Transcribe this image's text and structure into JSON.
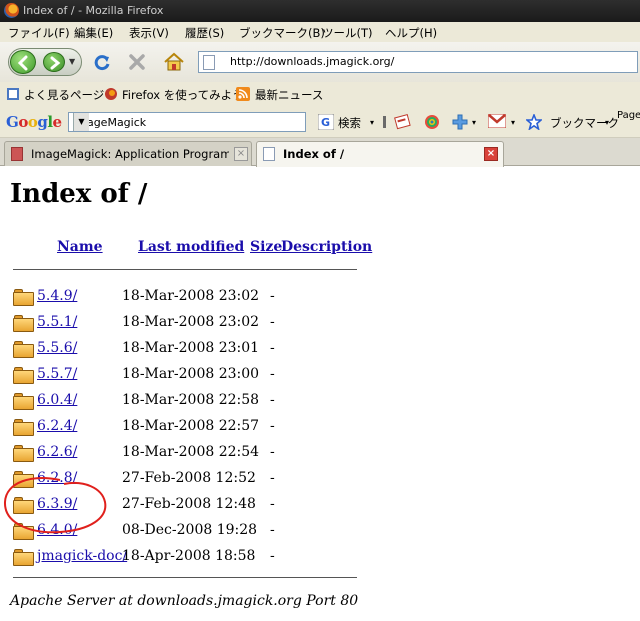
{
  "window": {
    "title": "Index of / - Mozilla Firefox"
  },
  "menu": [
    "ファイル(F)",
    "編集(E)",
    "表示(V)",
    "履歴(S)",
    "ブックマーク(B)",
    "ツール(T)",
    "ヘルプ(H)"
  ],
  "nav": {
    "url": "http://downloads.jmagick.org/"
  },
  "bookmarks": [
    "よく見るページ",
    "Firefox を使ってみよう",
    "最新ニュース"
  ],
  "google": {
    "logo": "Google",
    "query": "ImageMagick",
    "search_label": "検索",
    "bookmarks_label": "ブックマーク",
    "page_label": "Pagel"
  },
  "tabs": [
    {
      "label": "ImageMagick: Application Program Int...",
      "active": false
    },
    {
      "label": "Index of /",
      "active": true
    }
  ],
  "page": {
    "heading": "Index of /",
    "columns": [
      "Name",
      "Last modified",
      "Size",
      "Description"
    ],
    "rows": [
      {
        "name": "5.4.9/",
        "modified": "18-Mar-2008 23:02",
        "size": "-"
      },
      {
        "name": "5.5.1/",
        "modified": "18-Mar-2008 23:02",
        "size": "-"
      },
      {
        "name": "5.5.6/",
        "modified": "18-Mar-2008 23:01",
        "size": "-"
      },
      {
        "name": "5.5.7/",
        "modified": "18-Mar-2008 23:00",
        "size": "-"
      },
      {
        "name": "6.0.4/",
        "modified": "18-Mar-2008 22:58",
        "size": "-"
      },
      {
        "name": "6.2.4/",
        "modified": "18-Mar-2008 22:57",
        "size": "-"
      },
      {
        "name": "6.2.6/",
        "modified": "18-Mar-2008 22:54",
        "size": "-"
      },
      {
        "name": "6.2.8/",
        "modified": "27-Feb-2008 12:52",
        "size": "-"
      },
      {
        "name": "6.3.9/",
        "modified": "27-Feb-2008 12:48",
        "size": "-"
      },
      {
        "name": "6.4.0/",
        "modified": "08-Dec-2008 19:28",
        "size": "-"
      },
      {
        "name": "jmagick-doc/",
        "modified": "18-Apr-2008 18:58",
        "size": "-"
      }
    ],
    "footer": "Apache Server at downloads.jmagick.org Port 80"
  },
  "colors": {
    "link": "#1a0dab",
    "annotation": "#e0201c"
  }
}
